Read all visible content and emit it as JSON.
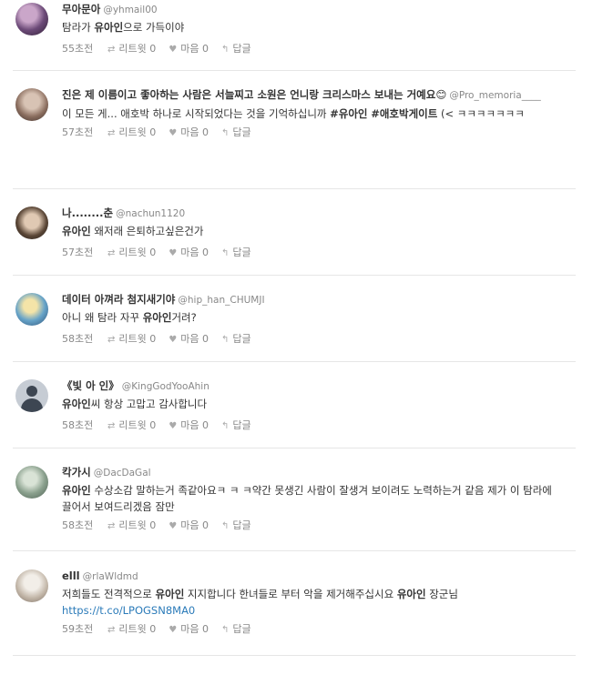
{
  "actions": {
    "retweet_label": "리트윗",
    "like_label": "마음",
    "reply_label": "답글"
  },
  "tweets": [
    {
      "name": "무아문아",
      "handle": "@yhmail00",
      "text": [
        "탐라가 ",
        "유아인",
        "으로 가득이야"
      ],
      "time": "55초전",
      "retweets": "0",
      "likes": "0"
    },
    {
      "name": "진은 제 이름이고 좋아하는 사람은 서늘찌고 소원은 언니랑 크리스마스 보내는 거예요😊",
      "handle": "@Pro_memoria____",
      "text": [
        "이 모든 게... 애호박 하나로 시작되었다는 것을 기억하십니까 ",
        "#유아인",
        " ",
        "#애호박게이트",
        " (< ㅋㅋㅋㅋㅋㅋㅋ"
      ],
      "time": "57초전",
      "retweets": "0",
      "likes": "0"
    },
    {
      "name": "나........춘",
      "handle": "@nachun1120",
      "text": [
        "유아인",
        " 왜저래 은퇴하고싶은건가"
      ],
      "time": "57초전",
      "retweets": "0",
      "likes": "0"
    },
    {
      "name": "데이터 아껴라 첨지새기야",
      "handle": "@hip_han_CHUMJI",
      "text": [
        "아니 왜 탐라 자꾸 ",
        "유아인",
        "거려?"
      ],
      "time": "58초전",
      "retweets": "0",
      "likes": "0"
    },
    {
      "name": "《빛 아 인》",
      "handle": "@KingGodYooAhin",
      "text": [
        "유아인",
        "씨 항상 고맙고 감사합니다"
      ],
      "time": "58초전",
      "retweets": "0",
      "likes": "0"
    },
    {
      "name": "칵가시",
      "handle": "@DacDaGal",
      "text": [
        "유아인",
        " 수상소감 말하는거 족같아요ㅋ ㅋ ㅋ약간 못생긴 사람이 잘생겨 보이려도 노력하는거 같음 제가 이 탐라에 끌어서 보여드리겠음 잠만"
      ],
      "time": "58초전",
      "retweets": "0",
      "likes": "0"
    },
    {
      "name": "elll",
      "handle": "@rlaWldmd",
      "text": [
        "저희들도 전격적으로 ",
        "유아인",
        " 지지합니다 한녀들로 부터 악을 제거해주십시요 ",
        "유아인",
        " 장군님 ",
        "https://t.co/LPOGSN8MA0"
      ],
      "time": "59초전",
      "retweets": "0",
      "likes": "0"
    }
  ]
}
